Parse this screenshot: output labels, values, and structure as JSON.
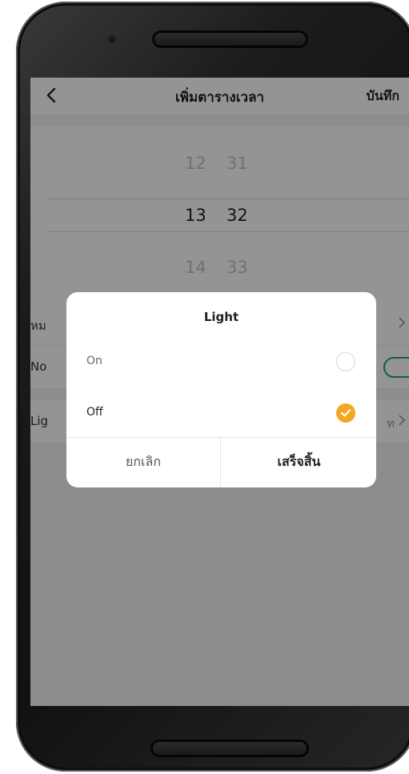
{
  "header": {
    "title": "เพิ่มตารางเวลา",
    "save_label": "บันทึก"
  },
  "picker": {
    "rows": [
      {
        "hour": "12",
        "minute": "31",
        "state": "faded"
      },
      {
        "hour": "13",
        "minute": "32",
        "state": "selected"
      },
      {
        "hour": "14",
        "minute": "33",
        "state": "faded"
      }
    ]
  },
  "settings": {
    "repeat_label": "หม",
    "notification_label": "No",
    "notification_on": true,
    "light_label": "Lig",
    "light_value": "ท"
  },
  "dialog": {
    "title": "Light",
    "options": [
      {
        "label": "On",
        "selected": false
      },
      {
        "label": "Off",
        "selected": true
      }
    ],
    "cancel_label": "ยกเลิก",
    "done_label": "เสร็จสิ้น"
  },
  "colors": {
    "accent_orange": "#f5a623",
    "toggle_green": "#1ea574"
  }
}
